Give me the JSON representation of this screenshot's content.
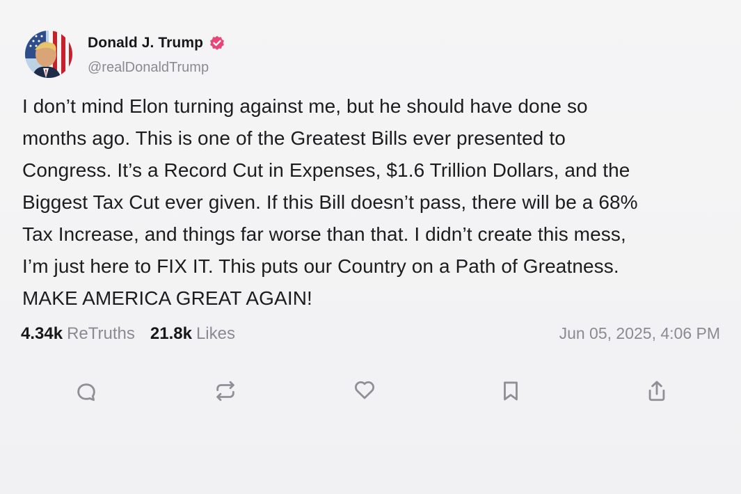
{
  "author": {
    "display_name": "Donald J. Trump",
    "handle": "@realDonaldTrump",
    "verified": true,
    "verified_color": "#e8457a"
  },
  "post": {
    "lines": [
      "I don’t mind Elon turning against me, but he should have done so",
      "months ago. This is one of the Greatest Bills ever presented to",
      "Congress. It’s a Record Cut in Expenses, $1.6 Trillion Dollars, and the",
      "Biggest Tax Cut ever given. If this Bill doesn’t pass, there will be a 68%",
      "Tax Increase, and things far worse than that. I didn’t create this mess,",
      "I’m just here to FIX IT. This puts our Country on a Path of Greatness.",
      "MAKE AMERICA GREAT AGAIN!"
    ]
  },
  "stats": {
    "retruths_count": "4.34k",
    "retruths_label": "ReTruths",
    "likes_count": "21.8k",
    "likes_label": "Likes",
    "timestamp": "Jun 05, 2025, 4:06 PM"
  },
  "actions": [
    {
      "name": "reply",
      "icon": "comment-icon"
    },
    {
      "name": "retruth",
      "icon": "repost-icon"
    },
    {
      "name": "like",
      "icon": "heart-icon"
    },
    {
      "name": "bookmark",
      "icon": "bookmark-icon"
    },
    {
      "name": "share",
      "icon": "share-icon"
    }
  ],
  "colors": {
    "background": "#f3f3f4",
    "text": "#1c1c1e",
    "muted": "#8a8a92",
    "icon": "#8f8f98"
  }
}
